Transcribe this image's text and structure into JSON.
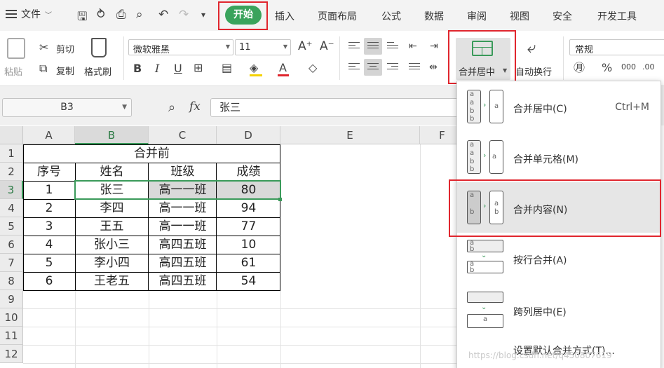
{
  "menu": {
    "file": "文件",
    "tabs": [
      "插入",
      "页面布局",
      "公式",
      "数据",
      "审阅",
      "视图",
      "安全",
      "开发工具"
    ],
    "active_tab": "开始"
  },
  "ribbon": {
    "paste": "粘贴",
    "cut": "剪切",
    "copy": "复制",
    "format_painter": "格式刷",
    "font_name": "微软雅黑",
    "font_size": "11",
    "merge_center": "合并居中",
    "wrap_text": "自动换行",
    "number_format": "常规"
  },
  "formula_bar": {
    "name_box": "B3",
    "fx": "fx",
    "value": "张三"
  },
  "columns": [
    "A",
    "B",
    "C",
    "D",
    "E",
    "F"
  ],
  "rows": [
    "1",
    "2",
    "3",
    "4",
    "5",
    "6",
    "7",
    "8",
    "9",
    "10",
    "11",
    "12"
  ],
  "table": {
    "title": "合并前",
    "headers": [
      "序号",
      "姓名",
      "班级",
      "成绩"
    ],
    "rows": [
      [
        "1",
        "张三",
        "高一一班",
        "80"
      ],
      [
        "2",
        "李四",
        "高一一班",
        "94"
      ],
      [
        "3",
        "王五",
        "高一一班",
        "77"
      ],
      [
        "4",
        "张小三",
        "高四五班",
        "10"
      ],
      [
        "5",
        "李小四",
        "高四五班",
        "61"
      ],
      [
        "6",
        "王老五",
        "高四五班",
        "54"
      ]
    ]
  },
  "merge_menu": {
    "items": [
      {
        "label": "合并居中(C)",
        "shortcut": "Ctrl+M"
      },
      {
        "label": "合并单元格(M)",
        "shortcut": ""
      },
      {
        "label": "合并内容(N)",
        "shortcut": ""
      },
      {
        "label": "按行合并(A)",
        "shortcut": ""
      },
      {
        "label": "跨列居中(E)",
        "shortcut": ""
      }
    ],
    "footer": "设置默认合并方式(T)..."
  },
  "watermark": "https://blog.csdn.net/q450807619",
  "colors": {
    "accent_green": "#3aa35c",
    "highlight_red": "#e0262e",
    "selection_green": "#3a9a5a"
  }
}
